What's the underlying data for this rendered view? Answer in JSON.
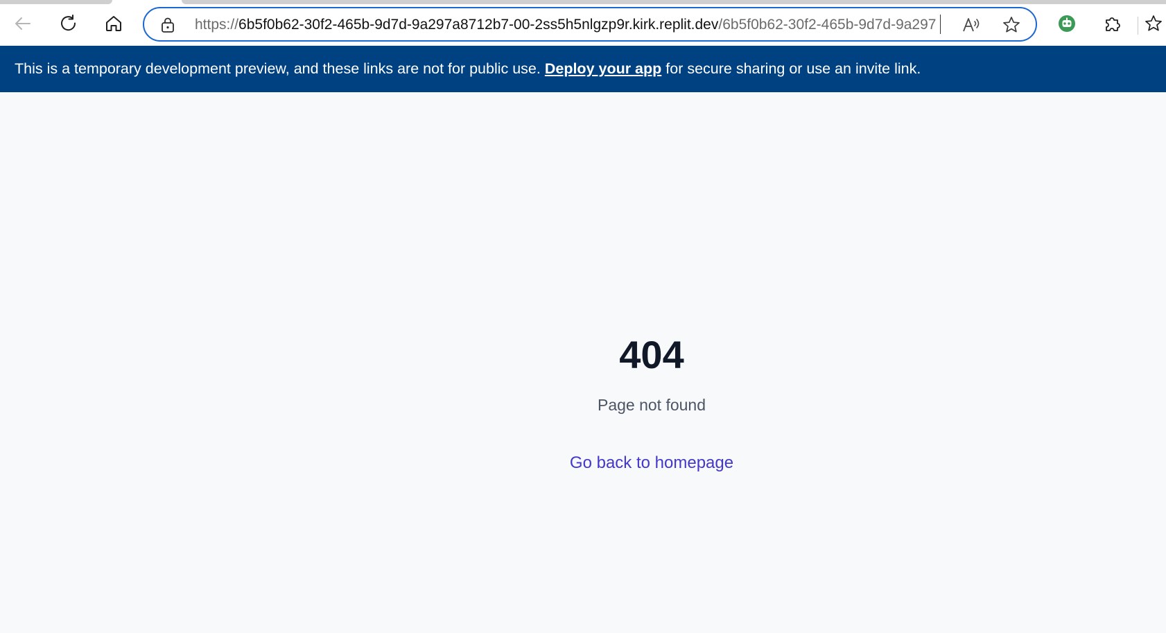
{
  "browser": {
    "address": {
      "scheme": "https://",
      "host": "6b5f0b62-30f2-465b-9d7d-9a297a8712b7-00-2ss5h5nlgzp9r.kirk.replit.dev",
      "path": "/6b5f0b62-30f2-465b-9d7d-9a297"
    },
    "icons": {
      "back": "back-arrow-icon",
      "reload": "reload-icon",
      "home": "home-icon",
      "lock": "lock-icon",
      "read_aloud": "read-aloud-icon",
      "favorite": "star-icon",
      "extension": "extension-icon",
      "puzzle": "puzzle-icon"
    },
    "accent_color": "#1a66d2"
  },
  "banner": {
    "text_before": "This is a temporary development preview, and these links are not for public use. ",
    "link_label": "Deploy your app",
    "text_after": " for secure sharing or use an invite link.",
    "background_color": "#004182"
  },
  "error_page": {
    "code": "404",
    "message": "Page not found",
    "link_label": "Go back to homepage",
    "link_color": "#4338ca"
  }
}
